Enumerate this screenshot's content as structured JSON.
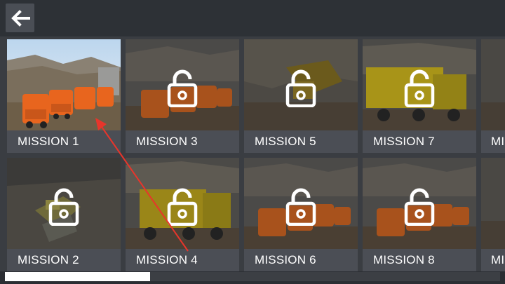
{
  "header": {
    "back_icon": "arrow-left-icon"
  },
  "missions": [
    {
      "label": "MISSION 1",
      "locked": false,
      "scene": "tankers-day"
    },
    {
      "label": "MISSION 2",
      "locked": true,
      "scene": "bulldozer"
    },
    {
      "label": "MISSION 3",
      "locked": true,
      "scene": "tankers"
    },
    {
      "label": "MISSION 4",
      "locked": true,
      "scene": "dump-truck"
    },
    {
      "label": "MISSION 5",
      "locked": true,
      "scene": "excavator"
    },
    {
      "label": "MISSION 6",
      "locked": true,
      "scene": "tankers"
    },
    {
      "label": "MISSION 7",
      "locked": true,
      "scene": "dump-truck"
    },
    {
      "label": "MISSION 8",
      "locked": true,
      "scene": "tankers"
    },
    {
      "label": "MI",
      "locked": true,
      "scene": "partial"
    },
    {
      "label": "MI",
      "locked": true,
      "scene": "partial"
    }
  ],
  "scroll": {
    "thumb_fraction": 0.29,
    "position": 0.0
  },
  "colors": {
    "tanker": "#e8651e",
    "dump_truck": "#d9c020",
    "caption_bg": "#4b4e55"
  }
}
